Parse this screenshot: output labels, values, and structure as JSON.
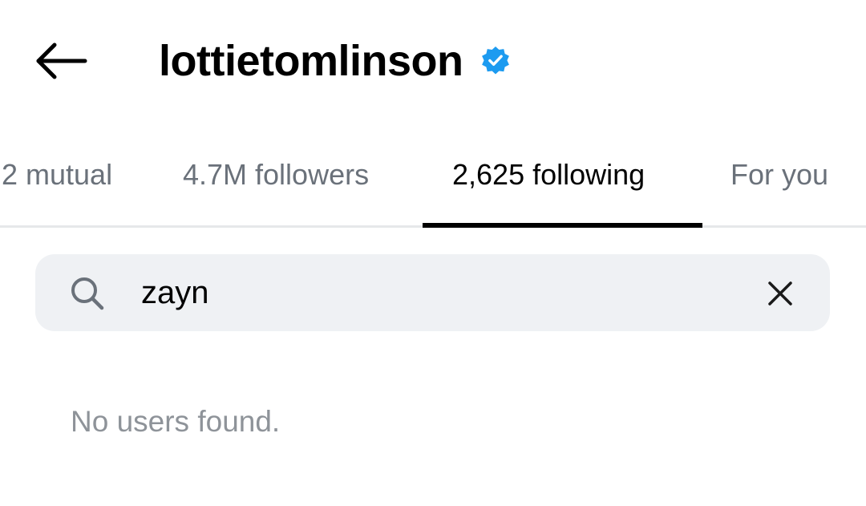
{
  "header": {
    "username": "lottietomlinson",
    "verified": true,
    "back_icon": "arrow-left-icon",
    "verified_icon": "verified-badge-icon",
    "verified_color": "#1d9bf0"
  },
  "tabs": [
    {
      "label": "2 mutual",
      "active": false
    },
    {
      "label": "4.7M followers",
      "active": false
    },
    {
      "label": "2,625 following",
      "active": true
    },
    {
      "label": "For you",
      "active": false
    }
  ],
  "search": {
    "value": "zayn",
    "search_icon": "search-icon",
    "clear_icon": "close-icon"
  },
  "results": {
    "empty_message": "No users found."
  }
}
